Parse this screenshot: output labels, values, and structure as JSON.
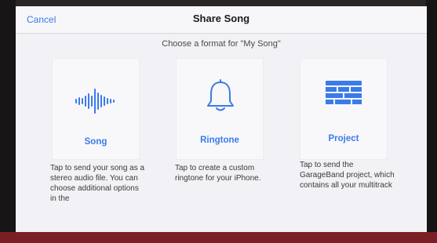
{
  "nav": {
    "cancel_label": "Cancel",
    "title": "Share Song"
  },
  "subtitle": "Choose a format for \"My Song\"",
  "options": [
    {
      "label": "Song",
      "icon": "waveform-icon",
      "description": "Tap to send your song as a stereo audio file. You can choose additional options in the"
    },
    {
      "label": "Ringtone",
      "icon": "bell-icon",
      "description": "Tap to create a custom ringtone for your iPhone."
    },
    {
      "label": "Project",
      "icon": "garageband-project-icon",
      "description": "Tap to send the GarageBand project, which contains all your multitrack"
    }
  ],
  "colors": {
    "accent": "#3b7be8",
    "background": "#f2f1f5"
  }
}
